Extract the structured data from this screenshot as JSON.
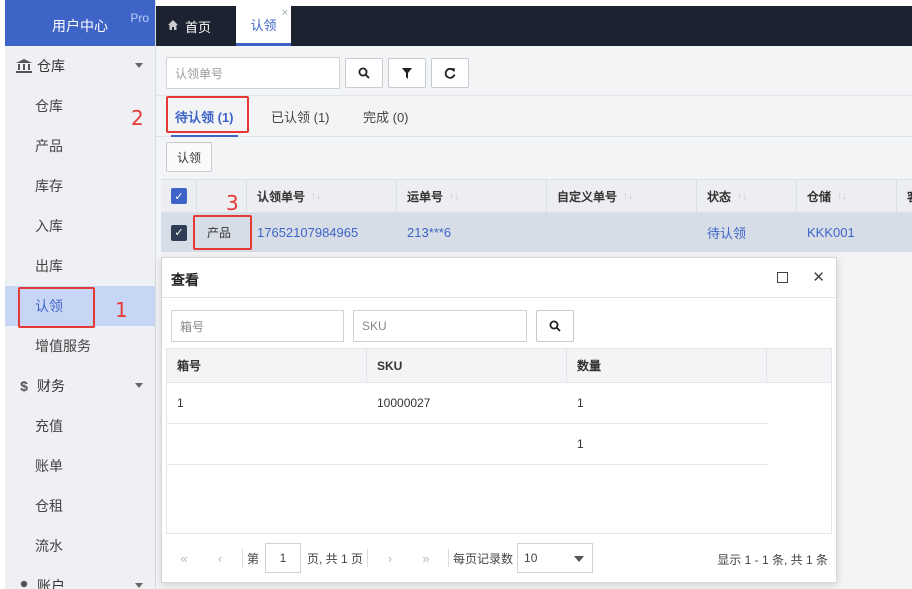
{
  "brand": {
    "title": "用户中心",
    "badge": "Pro"
  },
  "sidebar": {
    "groups": [
      {
        "label": "仓库",
        "icon": "bank-icon"
      },
      {
        "label": "财务",
        "icon": "dollar-icon"
      },
      {
        "label": "账户",
        "icon": "user-icon"
      }
    ],
    "warehouse_items": [
      "仓库",
      "产品",
      "库存",
      "入库",
      "出库",
      "认领",
      "增值服务"
    ],
    "finance_items": [
      "充值",
      "账单",
      "仓租",
      "流水"
    ],
    "active_item": "认领"
  },
  "tabs": {
    "home": "首页",
    "active": "认领",
    "close": "×"
  },
  "toolbar": {
    "search_placeholder": "认领单号"
  },
  "status_tabs": [
    {
      "label": "待认领 (1)",
      "active": true
    },
    {
      "label": "已认领 (1)",
      "active": false
    },
    {
      "label": "完成 (0)",
      "active": false
    }
  ],
  "claim_button": "认领",
  "grid": {
    "columns": [
      "认领单号",
      "运单号",
      "自定义单号",
      "状态",
      "仓储",
      "客"
    ],
    "rows": [
      {
        "product": "产品",
        "claim_no": "17652107984965",
        "tracking": "213***6",
        "custom": "",
        "status": "待认领",
        "warehouse": "KKK001"
      }
    ]
  },
  "modal": {
    "title": "查看",
    "box_placeholder": "箱号",
    "sku_placeholder": "SKU",
    "columns": [
      "箱号",
      "SKU",
      "数量"
    ],
    "rows": [
      {
        "box": "1",
        "sku": "10000027",
        "qty": "1"
      },
      {
        "box": "",
        "sku": "",
        "qty": "1"
      }
    ],
    "pager": {
      "page_prefix": "第",
      "page": "1",
      "page_suffix": "页, 共 1 页",
      "per_page_label": "每页记录数",
      "per_page": "10",
      "info": "显示 1 - 1 条, 共 1 条"
    }
  },
  "annotations": [
    "1",
    "2",
    "3"
  ],
  "colors": {
    "accent": "#3e64c8",
    "topbar": "#1d2230",
    "annotation": "#e53935"
  }
}
